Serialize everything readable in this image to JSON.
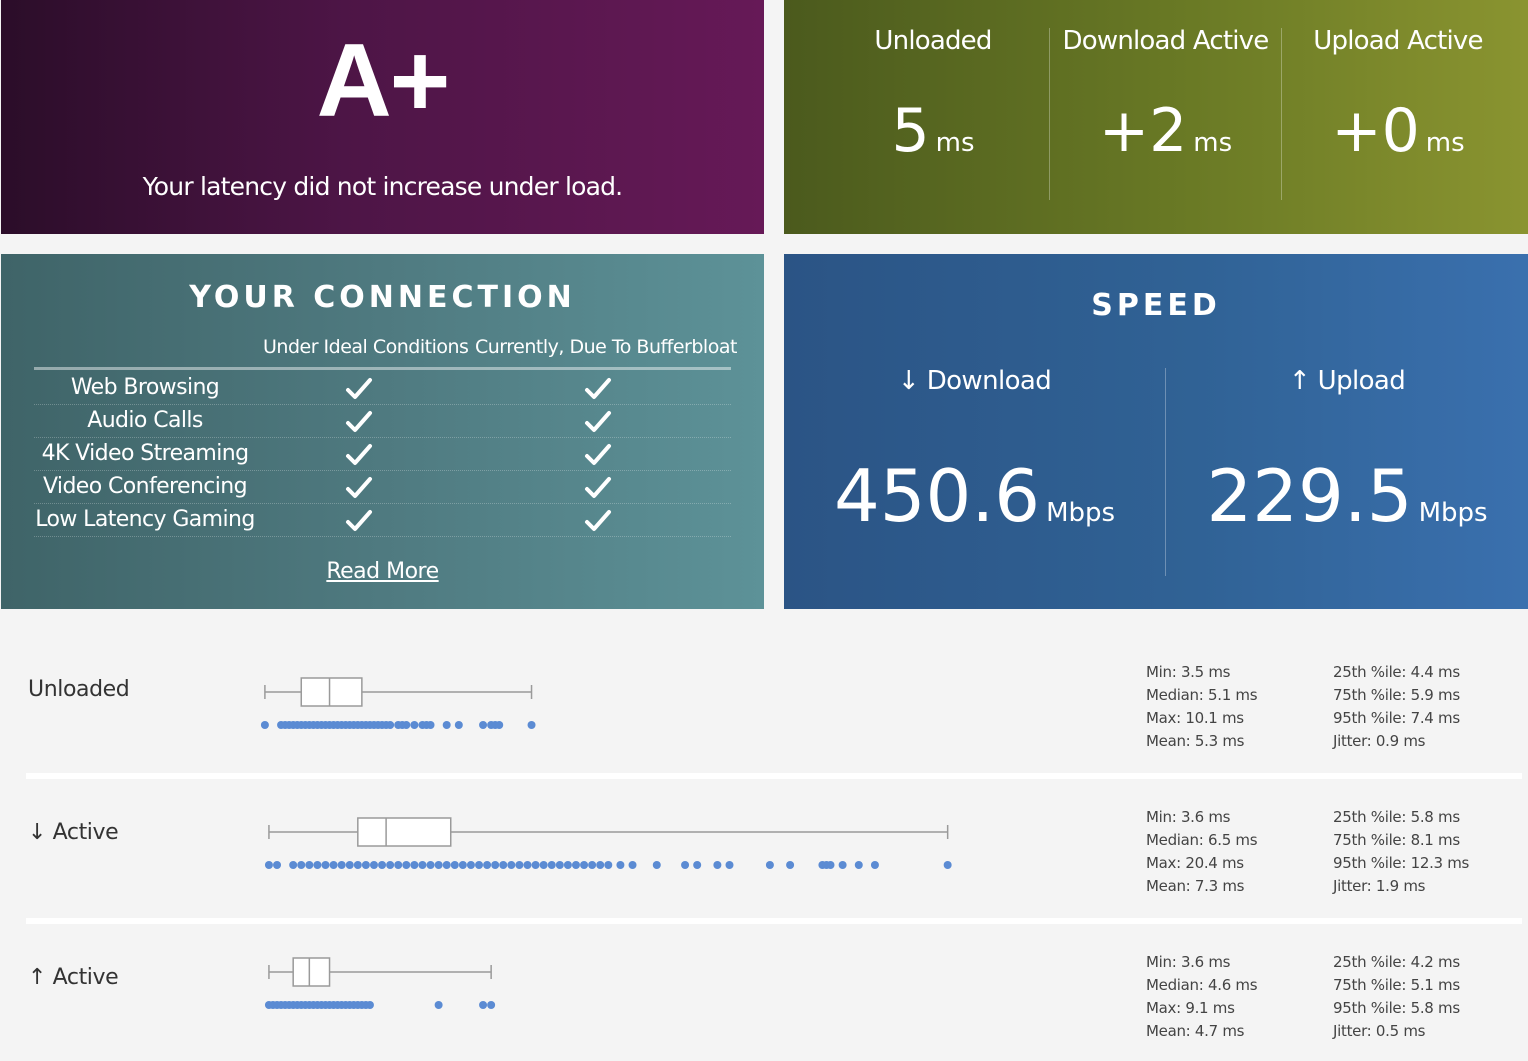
{
  "grade": {
    "value": "A+",
    "message": "Your latency did not increase under load."
  },
  "latency": [
    {
      "label": "Unloaded",
      "value": "5",
      "unit": "ms"
    },
    {
      "label": "Download Active",
      "value": "+2",
      "unit": "ms"
    },
    {
      "label": "Upload Active",
      "value": "+0",
      "unit": "ms"
    }
  ],
  "connection": {
    "title": "YOUR CONNECTION",
    "col_ideal": "Under Ideal Conditions",
    "col_current": "Currently, Due To Bufferbloat",
    "rows": [
      {
        "label": "Web Browsing",
        "ideal": true,
        "current": true
      },
      {
        "label": "Audio Calls",
        "ideal": true,
        "current": true
      },
      {
        "label": "4K Video Streaming",
        "ideal": true,
        "current": true
      },
      {
        "label": "Video Conferencing",
        "ideal": true,
        "current": true
      },
      {
        "label": "Low Latency Gaming",
        "ideal": true,
        "current": true
      }
    ],
    "read_more": "Read More",
    "check_icon": "check-icon"
  },
  "speed": {
    "title": "SPEED",
    "download": {
      "label": "↓ Download",
      "value": "450.6",
      "unit": "Mbps"
    },
    "upload": {
      "label": "↑ Upload",
      "value": "229.5",
      "unit": "Mbps"
    }
  },
  "chart_data": {
    "type": "boxplot",
    "x_unit": "ms",
    "colors": {
      "points": "#5b8bd3",
      "box": "#9a9a9a"
    },
    "series": [
      {
        "name": "Unloaded",
        "min": 3.5,
        "q1": 4.4,
        "median": 5.1,
        "q3": 5.9,
        "p95": 7.4,
        "max": 10.1,
        "mean": 5.3,
        "jitter": 0.9,
        "points": [
          3.5,
          3.9,
          4.0,
          4.1,
          4.2,
          4.3,
          4.4,
          4.5,
          4.6,
          4.7,
          4.8,
          4.9,
          5.0,
          5.1,
          5.2,
          5.3,
          5.4,
          5.5,
          5.6,
          5.7,
          5.8,
          5.9,
          6.0,
          6.1,
          6.2,
          6.3,
          6.4,
          6.5,
          6.6,
          6.8,
          6.9,
          7.0,
          7.2,
          7.4,
          7.5,
          7.6,
          8.0,
          8.3,
          8.9,
          9.1,
          9.2,
          9.3,
          10.1
        ]
      },
      {
        "name": "↓ Active",
        "min": 3.6,
        "q1": 5.8,
        "median": 6.5,
        "q3": 8.1,
        "p95": 12.3,
        "max": 20.4,
        "mean": 7.3,
        "jitter": 1.9,
        "points": [
          3.6,
          3.8,
          4.2,
          4.4,
          4.6,
          4.8,
          5.0,
          5.2,
          5.4,
          5.6,
          5.8,
          6.0,
          6.2,
          6.4,
          6.6,
          6.8,
          7.0,
          7.2,
          7.4,
          7.6,
          7.8,
          8.0,
          8.2,
          8.4,
          8.6,
          8.8,
          9.0,
          9.2,
          9.4,
          9.6,
          9.8,
          10.0,
          10.2,
          10.4,
          10.6,
          10.8,
          11.0,
          11.2,
          11.4,
          11.6,
          11.8,
          12.0,
          12.3,
          12.6,
          13.2,
          13.9,
          14.2,
          14.7,
          15.0,
          16.0,
          16.5,
          17.3,
          17.4,
          17.5,
          17.8,
          18.2,
          18.6,
          20.4
        ]
      },
      {
        "name": "↑ Active",
        "min": 3.6,
        "q1": 4.2,
        "median": 4.6,
        "q3": 5.1,
        "p95": 5.8,
        "max": 9.1,
        "mean": 4.7,
        "jitter": 0.5,
        "points": [
          3.6,
          3.7,
          3.8,
          3.9,
          4.0,
          4.1,
          4.2,
          4.3,
          4.4,
          4.5,
          4.6,
          4.7,
          4.8,
          4.9,
          5.0,
          5.1,
          5.2,
          5.3,
          5.4,
          5.5,
          5.6,
          5.7,
          5.8,
          5.9,
          6.0,
          6.1,
          7.8,
          8.9,
          9.1
        ]
      }
    ]
  },
  "stats": [
    {
      "left": [
        "Min: 3.5 ms",
        "Median: 5.1 ms",
        "Max: 10.1 ms",
        "Mean: 5.3 ms"
      ],
      "right": [
        "25th %ile: 4.4 ms",
        "75th %ile: 5.9 ms",
        "95th %ile: 7.4 ms",
        "Jitter: 0.9 ms"
      ]
    },
    {
      "left": [
        "Min: 3.6 ms",
        "Median: 6.5 ms",
        "Max: 20.4 ms",
        "Mean: 7.3 ms"
      ],
      "right": [
        "25th %ile: 5.8 ms",
        "75th %ile: 8.1 ms",
        "95th %ile: 12.3 ms",
        "Jitter: 1.9 ms"
      ]
    },
    {
      "left": [
        "Min: 3.6 ms",
        "Median: 4.6 ms",
        "Max: 9.1 ms",
        "Mean: 4.7 ms"
      ],
      "right": [
        "25th %ile: 4.2 ms",
        "75th %ile: 5.1 ms",
        "95th %ile: 5.8 ms",
        "Jitter: 0.5 ms"
      ]
    }
  ]
}
